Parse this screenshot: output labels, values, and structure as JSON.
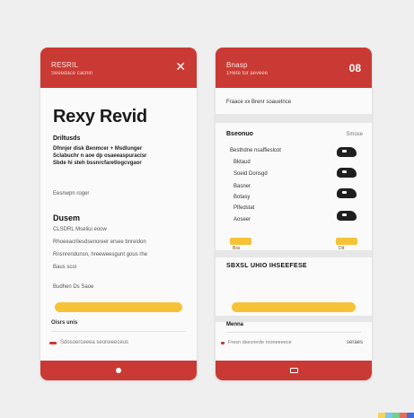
{
  "colors": {
    "brand_red": "#c93a34",
    "accent_yellow": "#f6c338",
    "card_bg": "#fafafa",
    "page_bg": "#efefef"
  },
  "left_card": {
    "header": {
      "title": "RESRIL",
      "subtitle": "Seeedace cacnin",
      "action_icon": "close-icon"
    },
    "heading": "Rexy Revid",
    "brand_line": "Driltusds",
    "desc_lines": [
      "Dfnnjer disk Benmcer + Msdlunger",
      "Sclabuchr n aoe dp osaeeaspuracisr",
      "Sbde hi steh bssnrcfaretlogcvgaor"
    ],
    "meta_line": "Eesnwpn roger",
    "section_title": "Dusem",
    "section_sub": "CLSDRL Mseliui eoow",
    "body_lines": [
      "Rhoeeacrilesdsenoreer ersee bnreidon",
      "Rnsnrendunsn, hreeweesgunt gous rhe",
      "Baus scoi"
    ],
    "note": "Budhen Ds Saoe",
    "link_label": "Oisrs unis",
    "footer_note": "Sdosoerceeea seoneeeceus",
    "footer_icon": "home-dot-icon"
  },
  "right_card": {
    "header": {
      "title": "Bnasp",
      "subtitle": "1Hete tur aeveee",
      "action_label": "08",
      "action_icon": "menu-icon"
    },
    "top_note": "Fraace xx Brenr soauetnce",
    "list_title": "Bseonuo",
    "list_tag": "Smose",
    "items": [
      {
        "label": "Besthdne nsaffieslcot",
        "icon": "shoe-icon"
      },
      {
        "label": "Bktaud",
        "icon": "shoe-icon"
      },
      {
        "label": "Soeid Donsgd",
        "icon": "shoe-icon"
      },
      {
        "label": "Basner",
        "icon": "shoe-icon"
      },
      {
        "label": "Botasy",
        "icon": "shoe-icon"
      },
      {
        "label": "Plfedstat",
        "icon": "shoe-icon"
      },
      {
        "label": "Aoseer",
        "icon": "shoe-icon"
      }
    ],
    "chip_left": "Bss",
    "chip_right": "Dd",
    "section_heading": "SBXSL UHIO IHSEEFESE",
    "bottom_label": "Menna",
    "footer_note": "Fresn dsecrerde nroneeeece",
    "footer_right": "seraes",
    "footer_icon": "tray-icon"
  }
}
